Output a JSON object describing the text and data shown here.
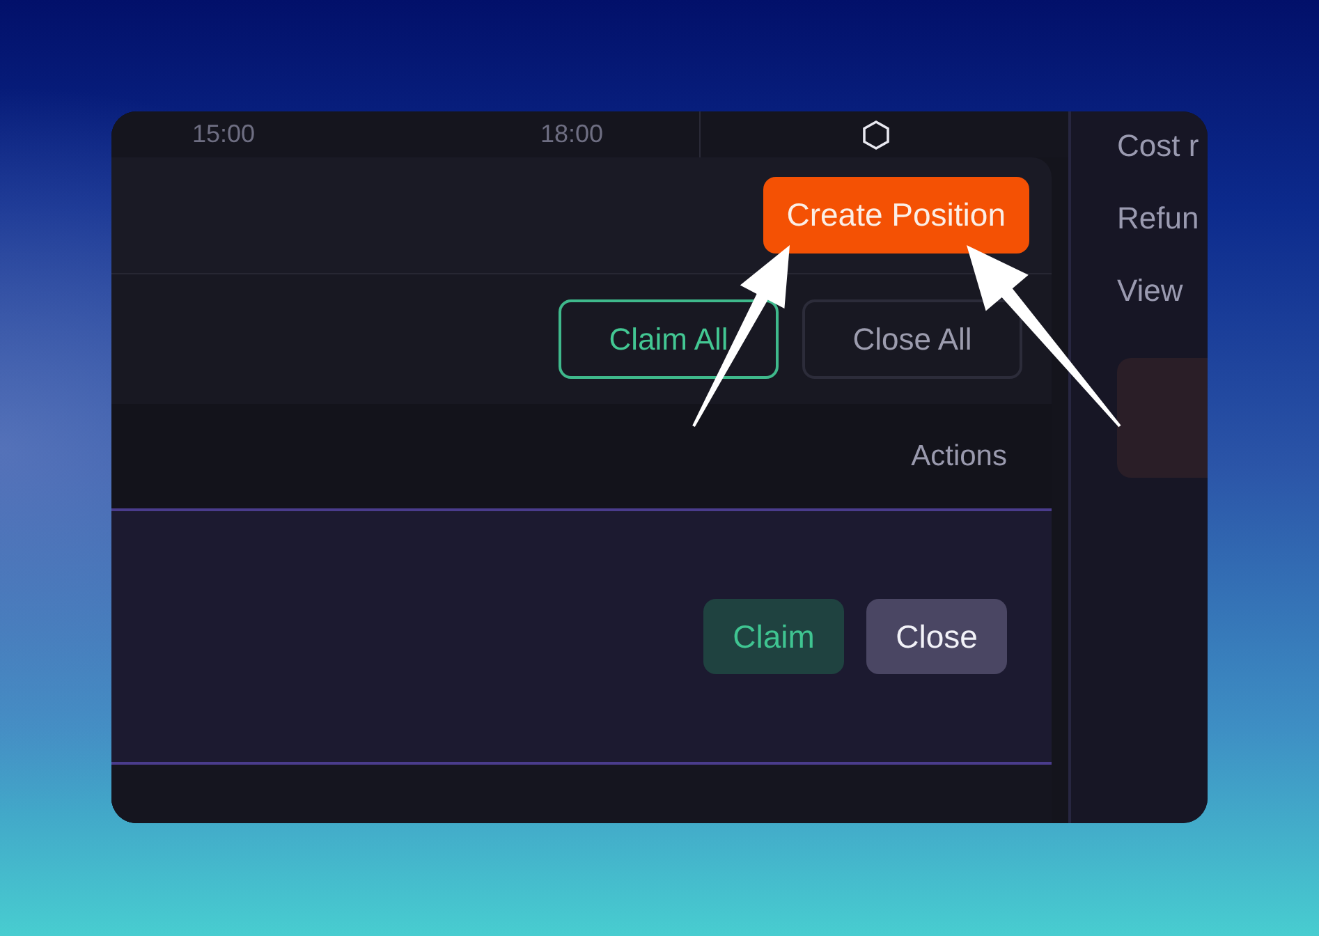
{
  "timeline": {
    "times": [
      "15:00",
      "18:00"
    ]
  },
  "positions_panel": {
    "create_button": "Create Position",
    "bulk_actions": [
      {
        "label": "Claim All",
        "kind": "claim"
      },
      {
        "label": "Close All",
        "kind": "close"
      }
    ],
    "table": {
      "columns": [
        "Actions"
      ],
      "rows": [
        {
          "actions": [
            {
              "label": "Claim",
              "kind": "claim"
            },
            {
              "label": "Close",
              "kind": "close"
            }
          ]
        }
      ]
    }
  },
  "side_panel": {
    "items": [
      "Cost r",
      "Refun",
      "View"
    ]
  }
}
